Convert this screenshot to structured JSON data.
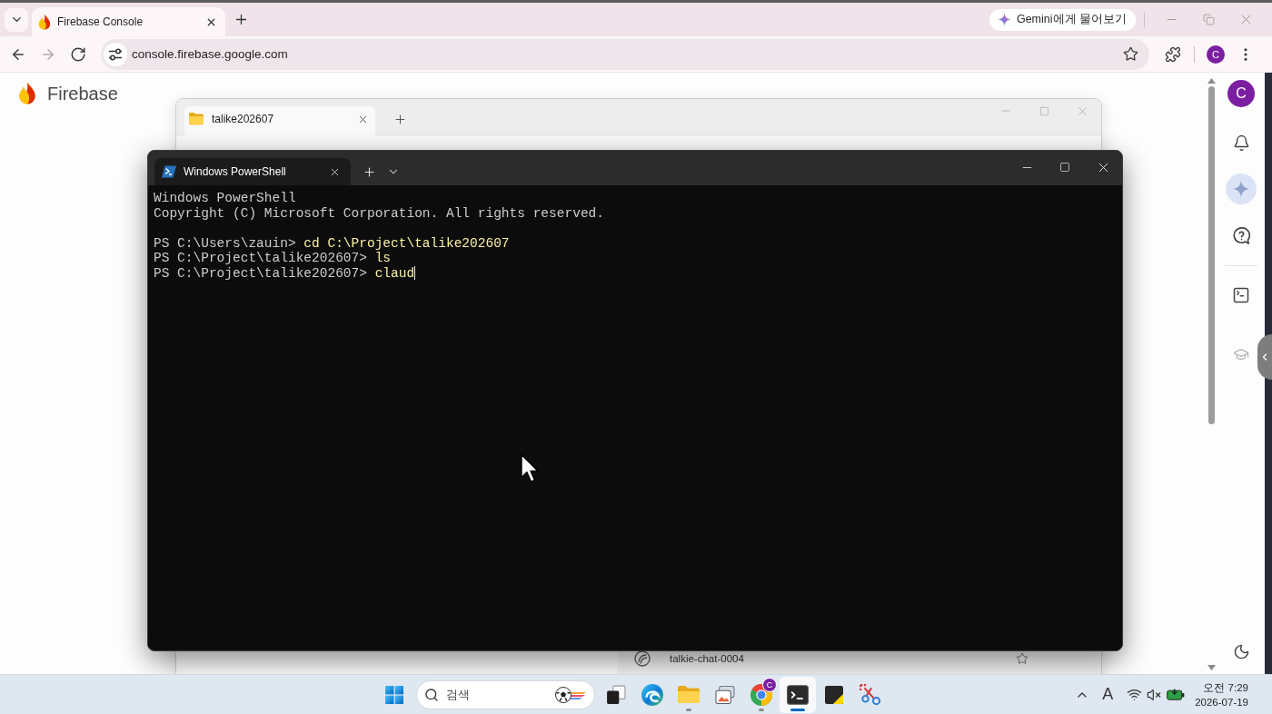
{
  "browser": {
    "tabs": [
      {
        "title": "Firebase Console",
        "selected": true
      }
    ],
    "gemini_button": "Gemini에게 물어보기",
    "nav_buttons": [
      {
        "kind": "back",
        "disabled": false
      },
      {
        "kind": "forward",
        "disabled": true
      },
      {
        "kind": "reload",
        "disabled": false
      }
    ],
    "address_bar": {
      "url": "console.firebase.google.com"
    },
    "profile_initial": "C"
  },
  "page": {
    "brand": "Firebase",
    "rail": {
      "avatar_initial": "C",
      "top_items": [
        {
          "kind": "notifications",
          "selected": false,
          "disabled": false
        },
        {
          "kind": "gemini",
          "selected": true,
          "disabled": false
        },
        {
          "kind": "help",
          "selected": false,
          "disabled": false
        }
      ],
      "middle_items": [
        {
          "kind": "terminal",
          "selected": false,
          "disabled": false
        },
        {
          "kind": "learn",
          "selected": false,
          "disabled": true
        }
      ],
      "bottom_items": [
        {
          "kind": "theme",
          "selected": false,
          "disabled": false
        }
      ]
    }
  },
  "file_explorer": {
    "tabs": [
      {
        "title": "talike202607",
        "selected": true
      }
    ],
    "rows": [
      {
        "name": "talkie-chat-0004"
      }
    ]
  },
  "terminal": {
    "tabs": [
      {
        "title": "Windows PowerShell",
        "selected": true
      }
    ],
    "banner": [
      "Windows PowerShell",
      "Copyright (C) Microsoft Corporation. All rights reserved."
    ],
    "commands": [
      {
        "prompt": "PS C:\\Users\\zauin>",
        "command": "cd C:\\Project\\talike202607",
        "cursor": false
      },
      {
        "prompt": "PS C:\\Project\\talike202607>",
        "command": "ls",
        "cursor": false
      },
      {
        "prompt": "PS C:\\Project\\talike202607>",
        "command": "claud",
        "cursor": true
      }
    ]
  },
  "taskbar": {
    "search": {
      "placeholder": "검색"
    },
    "apps": [
      {
        "kind": "task-view",
        "running": false,
        "active": false
      },
      {
        "kind": "edge",
        "running": false,
        "active": false
      },
      {
        "kind": "explorer",
        "running": true,
        "active": false
      },
      {
        "kind": "gallery",
        "running": false,
        "active": false
      },
      {
        "kind": "chrome",
        "running": true,
        "active": false,
        "badge": "C"
      },
      {
        "kind": "terminal",
        "running": true,
        "active": true
      },
      {
        "kind": "sticky-notes",
        "running": false,
        "active": false
      },
      {
        "kind": "snipping-tool",
        "running": false,
        "active": false
      }
    ],
    "tray": {
      "input_indicator": "A"
    },
    "clock": {
      "time": "오전 7:29",
      "date": "2026-07-19"
    }
  }
}
